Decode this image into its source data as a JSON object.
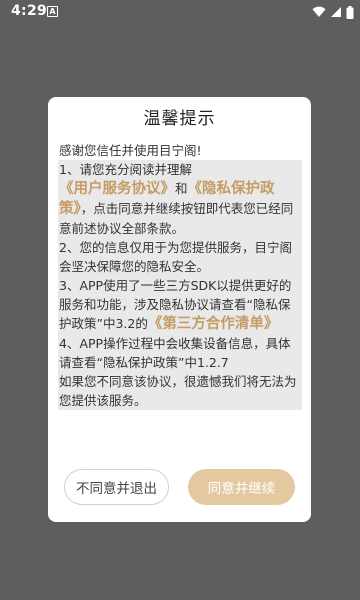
{
  "status_bar": {
    "time": "4:29",
    "notification_icon": "A",
    "icons": [
      "wifi-icon",
      "signal-icon",
      "battery-icon"
    ]
  },
  "dialog": {
    "title": "温馨提示",
    "greeting": "感谢您信任并使用目宁阁!",
    "p1": {
      "prefix": "1、请您充分阅读并理解",
      "link1": "《用户服务协议》",
      "and": "和",
      "link2": "《隐私保护政策》",
      "suffix": "，点击同意并继续按钮即代表您已经同意前述协议全部条款。"
    },
    "p2": "2、您的信息仅用于为您提供服务，目宁阁会坚决保障您的隐私安全。",
    "p3": {
      "prefix": "3、APP使用了一些三方SDK以提供更好的服务和功能，涉及隐私协议请查看“隐私保护政策”中3.2的",
      "link": "《第三方合作清单》"
    },
    "p4": "4、APP操作过程中会收集设备信息，具体请查看“隐私保护政策”中1.2.7",
    "p5": "如果您不同意该协议，很遗憾我们将无法为您提供该服务。",
    "decline_label": "不同意并退出",
    "accept_label": "同意并继续"
  },
  "colors": {
    "backdrop": "#5e5e5e",
    "link": "#c59c64",
    "accept_button": "#e4c9a0"
  }
}
